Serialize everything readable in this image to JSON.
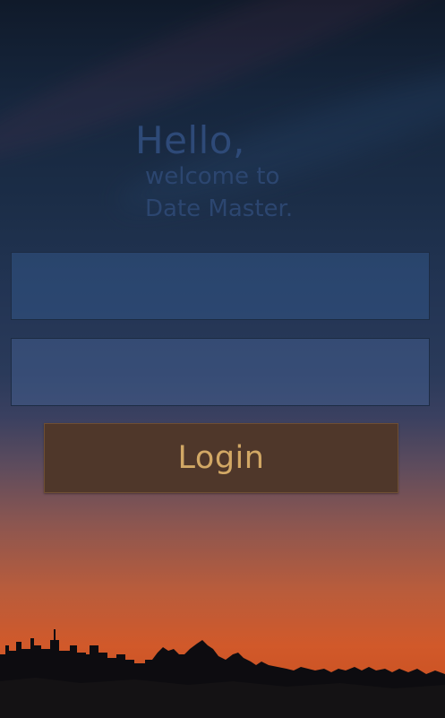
{
  "app": {
    "greeting": "Hello,",
    "subtitle_line1": "welcome to",
    "subtitle_line2": "Date Master."
  },
  "form": {
    "username": {
      "value": "",
      "placeholder": ""
    },
    "password": {
      "value": "",
      "placeholder": ""
    },
    "login_label": "Login"
  },
  "icons": {
    "moon": "crescent-moon-icon",
    "skyline": "city-skyline-silhouette"
  },
  "colors": {
    "greeting_text": "#2e4a78",
    "field_fill": "#3a5f96",
    "button_fill": "#4f372a",
    "button_text": "#d2a865",
    "horizon_orange": "#d1592a"
  }
}
